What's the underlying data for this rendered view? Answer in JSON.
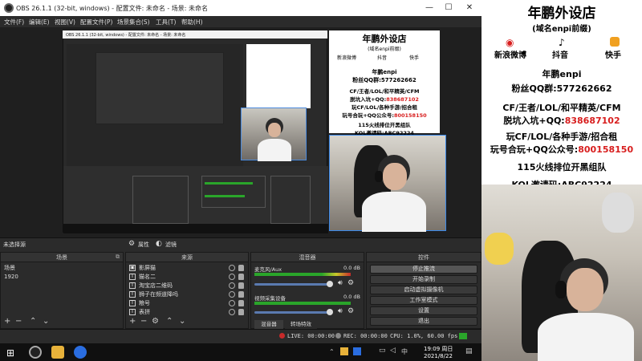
{
  "obs": {
    "window_title": "OBS 26.1.1 (32-bit, windows) - 配置文件: 未命名 - 场景: 未命名",
    "menu": [
      "文件(F)",
      "编辑(E)",
      "视图(V)",
      "配置文件(P)",
      "场景集合(S)",
      "工具(T)",
      "帮助(H)"
    ],
    "nested_title": "OBS 26.1.1 (32-bit, windows) - 配置文件: 未命名 - 场景: 未命名",
    "no_source_selected": "未选择源",
    "props_label": "属性",
    "filters_label": "滤镜",
    "scenes": {
      "title": "场景",
      "items": [
        "场景",
        "1920"
      ]
    },
    "sources": {
      "title": "来源",
      "items": [
        "影屏猫",
        "猫名二",
        "淘宝店二维码",
        "狮子在频道降吗",
        "粮号",
        "表拼"
      ]
    },
    "mixer": {
      "title": "混音器",
      "ch1_name": "麦克风/Aux",
      "ch1_db": "0.0 dB",
      "ch2_name": "视频采集设备",
      "ch2_db": "0.0 dB",
      "tab_mixer": "混音器",
      "tab_transitions": "转场特效"
    },
    "controls": {
      "title": "控件",
      "buttons": [
        "停止推流",
        "开始录制",
        "启动虚拟摄像机",
        "工作室模式",
        "设置",
        "退出"
      ]
    },
    "status": {
      "live": "LIVE: 00:00:00",
      "rec": "REC: 00:00:00",
      "cpu": "CPU: 1.0%, 60.00 fps"
    }
  },
  "promo": {
    "title": "年鹏外设店",
    "subtitle": "(域名enpi前缀)",
    "weibo_label": "新浪微博",
    "douyin_label": "抖音",
    "kuaishou_label": "快手",
    "brand": "年鹏enpi",
    "qq_group_label": "粉丝QQ群:",
    "qq_group_number": "577262662",
    "line1": "CF/王者/LOL/和平精英/CFM",
    "line2_prefix": "脱坑入坑+QQ:",
    "line2_number": "838687102",
    "line3": "玩CF/LOL/各种手游/招合租",
    "line4_prefix": "玩号合玩+QQ公众号:",
    "line4_number": "800158150",
    "line5": "115火线排位开黑组队",
    "line6_prefix": "KOL邀请码:",
    "line6_code": "ABC92224"
  },
  "taskbar": {
    "time": "19:09 周日",
    "date": "2021/8/22"
  },
  "colors": {
    "accent_blue": "#3a88e8",
    "promo_red": "#d81e1e"
  }
}
